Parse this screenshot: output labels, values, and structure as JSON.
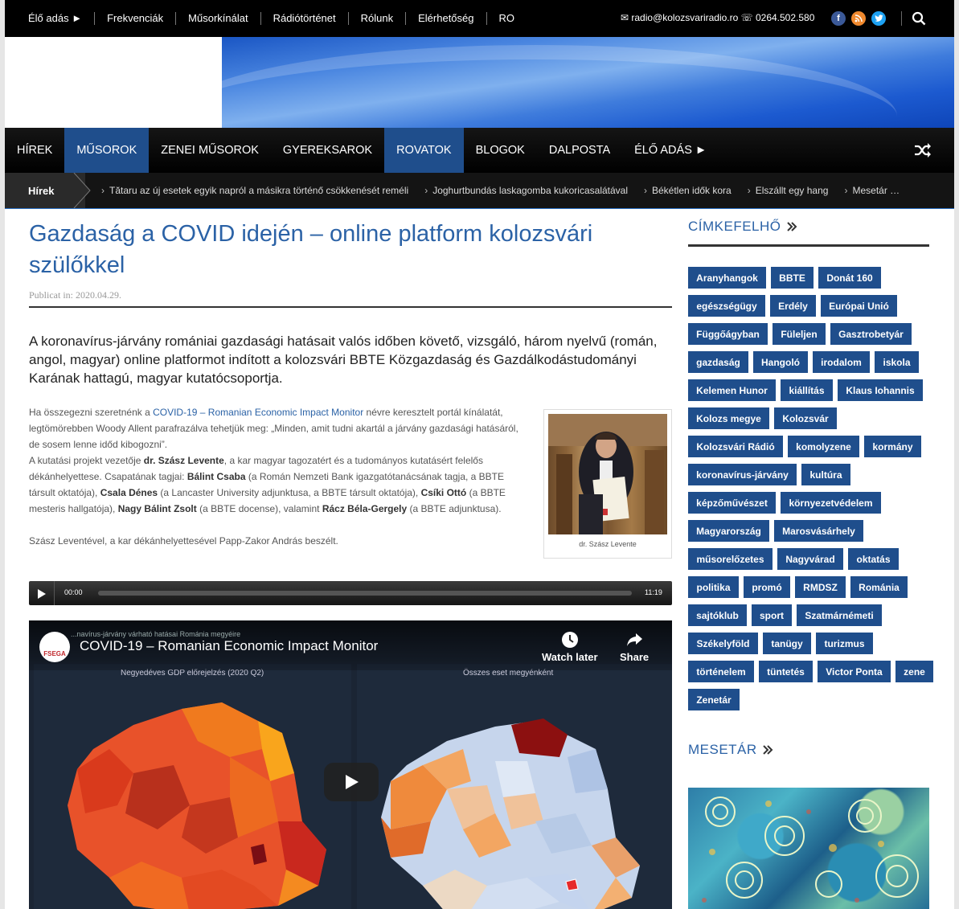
{
  "topbar": {
    "nav": [
      "Élő adás ►",
      "Frekvenciák",
      "Műsorkínálat",
      "Rádiótörténet",
      "Rólunk",
      "Elérhetőség",
      "RO"
    ],
    "contact": "✉ radio@kolozsvariradio.ro ☏ 0264.502.580",
    "social_icons": [
      "facebook-icon",
      "rss-icon",
      "twitter-icon"
    ],
    "colors": {
      "facebook": "#3b5998",
      "rss": "#f0892e",
      "twitter": "#1da1f2"
    }
  },
  "mainnav": {
    "items": [
      {
        "label": "HÍREK",
        "active": false
      },
      {
        "label": "MŰSOROK",
        "active": true
      },
      {
        "label": "ZENEI MŰSOROK",
        "active": false
      },
      {
        "label": "GYEREKSAROK",
        "active": false
      },
      {
        "label": "ROVATOK",
        "active": true
      },
      {
        "label": "BLOGOK",
        "active": false
      },
      {
        "label": "DALPOSTA",
        "active": false
      },
      {
        "label": "ÉLŐ ADÁS ►",
        "active": false
      }
    ],
    "accent": "#1f4e8c"
  },
  "ticker": {
    "label": "Hírek",
    "items": [
      "Tătaru az új esetek egyik napról a másikra történő csökkenését reméli",
      "Joghurtbundás laskagomba kukoricasalátával",
      "Békétlen idők kora",
      "Elszállt egy hang",
      "Mesetár …"
    ]
  },
  "article": {
    "title": "Gazdaság a COVID idején – online platform kolozsvári szülőkkel",
    "meta": "Publicat in: 2020.04.29.",
    "lead": "A koronavírus-járvány romániai gazdasági hatásait valós időben követő, vizsgáló, három nyelvű (román, angol, magyar) online platformot indított a kolozsvári BBTE Közgazdaság és Gazdálkodástudományi Karának hattagú, magyar kutatócsoportja.",
    "p1_before": "Ha összegezni szeretnénk a ",
    "p1_link": "COVID-19 – Romanian Economic Impact Monitor",
    "p1_after": " névre keresztelt portál kínálatát, legtömörebben Woody Allent parafrazálva tehetjük meg: „Minden, amit tudni akartál a járvány gazdasági hatásáról, de sosem lenne időd kibogozni”.",
    "p2": [
      {
        "t": "A kutatási projekt vezetője ",
        "b": false
      },
      {
        "t": "dr. Szász Levente",
        "b": true
      },
      {
        "t": ", a kar magyar tagozatért és a tudományos kutatásért felelős dékánhelyettese. Csapatának tagjai: ",
        "b": false
      },
      {
        "t": "Bálint Csaba",
        "b": true
      },
      {
        "t": " (a Román Nemzeti Bank igazgatótanácsának tagja, a BBTE társult oktatója), ",
        "b": false
      },
      {
        "t": "Csala Dénes",
        "b": true
      },
      {
        "t": " (a Lancaster University adjunktusa, a BBTE társult oktatója), ",
        "b": false
      },
      {
        "t": "Csíki Ottó",
        "b": true
      },
      {
        "t": " (a BBTE mesteris hallgatója), ",
        "b": false
      },
      {
        "t": "Nagy Bálint Zsolt",
        "b": true
      },
      {
        "t": " (a BBTE docense), valamint ",
        "b": false
      },
      {
        "t": "Rácz Béla-Gergely",
        "b": true
      },
      {
        "t": " (a BBTE adjunktusa).",
        "b": false
      }
    ],
    "p3": "Szász Leventével, a kar dékánhelyettesével Papp-Zakor András beszélt.",
    "figure_caption": "dr. Szász Levente",
    "audio": {
      "current": "00:00",
      "duration": "11:19",
      "progress": 0
    },
    "video": {
      "channel_logo": "FSEGA",
      "title": "COVID-19 – Romanian Economic Impact Monitor",
      "subtitle": "...navírus-járvány várható hatásai Románia megyéire",
      "watch_later": "Watch later",
      "share": "Share",
      "left_caption": "Negyedéves GDP előrejelzés (2020 Q2)",
      "right_caption": "Összes eset megyénként"
    }
  },
  "sidebar": {
    "tagcloud_title": "CÍMKEFELHŐ",
    "tags": [
      "Aranyhangok",
      "BBTE",
      "Donát 160",
      "egészségügy",
      "Erdély",
      "Európai Unió",
      "Függőágyban",
      "Füleljen",
      "Gasztrobetyár",
      "gazdaság",
      "Hangoló",
      "irodalom",
      "iskola",
      "Kelemen Hunor",
      "kiállítás",
      "Klaus Iohannis",
      "Kolozs megye",
      "Kolozsvár",
      "Kolozsvári Rádió",
      "komolyzene",
      "kormány",
      "koronavírus-járvány",
      "kultúra",
      "képzőművészet",
      "környezetvédelem",
      "Magyarország",
      "Marosvásárhely",
      "műsorelőzetes",
      "Nagyvárad",
      "oktatás",
      "politika",
      "promó",
      "RMDSZ",
      "Románia",
      "sajtóklub",
      "sport",
      "Szatmárnémeti",
      "Székelyföld",
      "tanügy",
      "turizmus",
      "történelem",
      "tüntetés",
      "Victor Ponta",
      "zene",
      "Zenetár"
    ],
    "mesetar_title": "MESETÁR"
  }
}
